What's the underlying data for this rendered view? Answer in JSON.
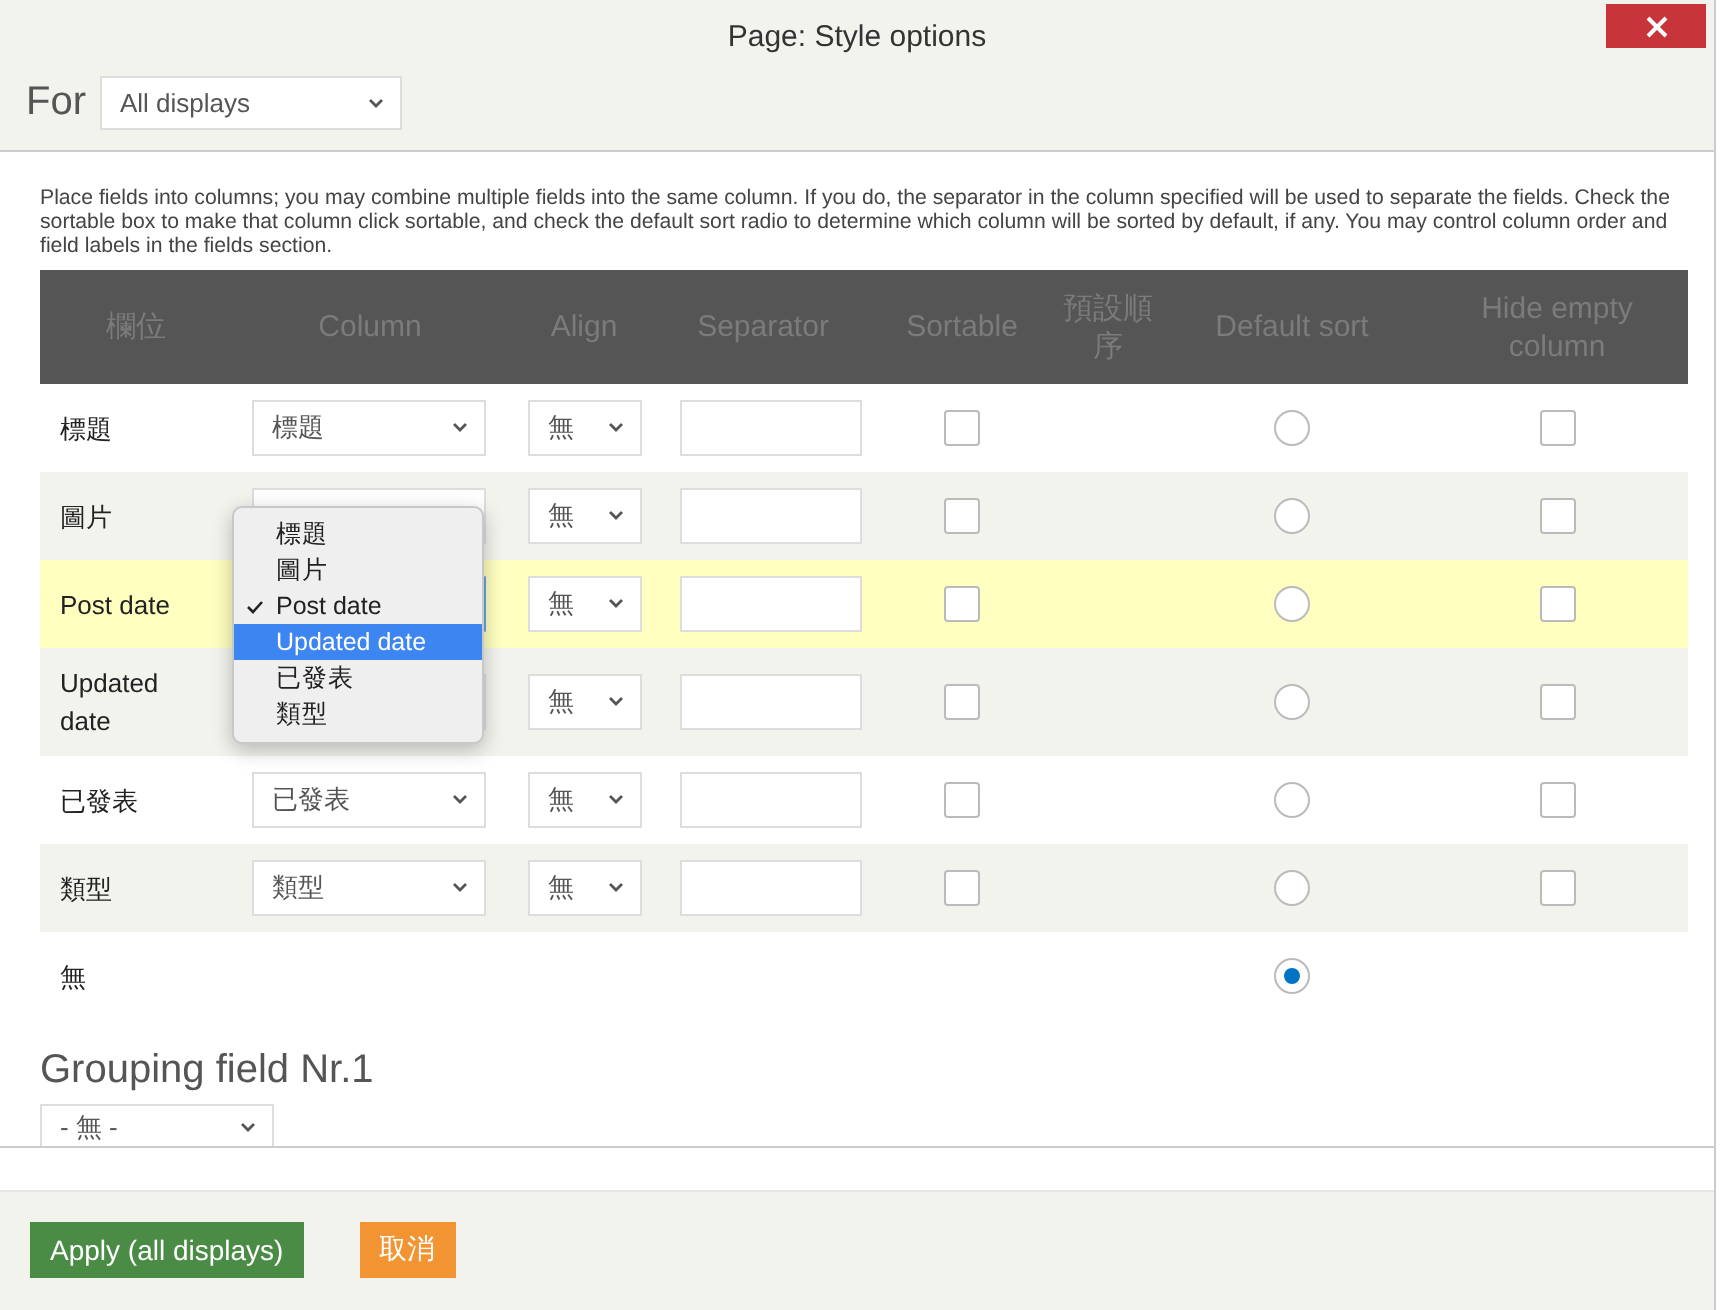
{
  "dialog": {
    "title": "Page: Style options",
    "for_label": "For",
    "for_value": "All displays"
  },
  "description": "Place fields into columns; you may combine multiple fields into the same column. If you do, the separator in the column specified will be used to separate the fields. Check the sortable box to make that column click sortable, and check the default sort radio to determine which column will be sorted by default, if any. You may control column order and field labels in the fields section.",
  "table": {
    "columns": [
      "欄位",
      "Column",
      "Align",
      "Separator",
      "Sortable",
      "預設順序",
      "Default sort",
      "Hide empty column"
    ],
    "rows": [
      {
        "kind": "field",
        "label": "標題",
        "column": "標題",
        "align": "無",
        "sortable": false,
        "default_sort": false,
        "hide_empty": false,
        "highlighted": false
      },
      {
        "kind": "field",
        "label": "圖片",
        "align": "無",
        "sortable": false,
        "default_sort": false,
        "hide_empty": false,
        "highlighted": false
      },
      {
        "kind": "field",
        "label": "Post date",
        "align": "無",
        "sortable": false,
        "default_sort": false,
        "hide_empty": false,
        "highlighted": true
      },
      {
        "kind": "field",
        "label": "Updated date",
        "align": "無",
        "sortable": false,
        "default_sort": false,
        "hide_empty": false,
        "highlighted": false
      },
      {
        "kind": "field",
        "label": "已發表",
        "column": "已發表",
        "align": "無",
        "sortable": false,
        "default_sort": false,
        "hide_empty": false,
        "highlighted": false
      },
      {
        "kind": "field",
        "label": "類型",
        "column": "類型",
        "align": "無",
        "sortable": false,
        "default_sort": false,
        "hide_empty": false,
        "highlighted": false
      },
      {
        "kind": "none",
        "label": "無",
        "default_sort": true
      }
    ],
    "dropdown": {
      "options": [
        {
          "label": "標題",
          "selected": false,
          "highlighted": false
        },
        {
          "label": "圖片",
          "selected": false,
          "highlighted": false
        },
        {
          "label": "Post date",
          "selected": true,
          "highlighted": false
        },
        {
          "label": "Updated date",
          "selected": false,
          "highlighted": true
        },
        {
          "label": "已發表",
          "selected": false,
          "highlighted": false
        },
        {
          "label": "類型",
          "selected": false,
          "highlighted": false
        }
      ]
    }
  },
  "grouping": {
    "title": "Grouping field Nr.1",
    "value": "- 無 -"
  },
  "buttons": [
    {
      "label": "Apply (all displays)",
      "kind": "primary"
    },
    {
      "label": "取消",
      "kind": "cancel"
    }
  ]
}
